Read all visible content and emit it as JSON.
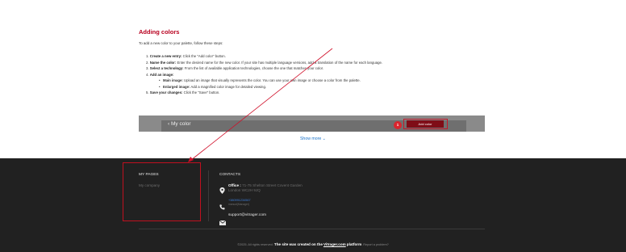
{
  "article": {
    "heading": "Adding colors",
    "intro": "To add a new color to your palette, follow these steps:",
    "steps": [
      {
        "num": "1.",
        "title": "Create a new entry:",
        "text": " Click the \"Add color\" button."
      },
      {
        "num": "2.",
        "title": "Name the color:",
        "text": " Enter the desired name for the new color. If your site has multiple language versions, add a translation of the name for each language."
      },
      {
        "num": "3.",
        "title": "Select a technology:",
        "text": " From the list of available application technologies, choose the one that matches your color."
      },
      {
        "num": "4.",
        "title": "Add an image:",
        "text": ""
      },
      {
        "num": "5.",
        "title": "Save your changes:",
        "text": " Click the \"Save\" button."
      }
    ],
    "substeps": [
      {
        "title": "Main image:",
        "text": " Upload an image that visually represents the color. You can use your own image or choose a color from the palette."
      },
      {
        "title": "Enlarged image:",
        "text": " Add a magnified color image for detailed viewing."
      }
    ]
  },
  "banner": {
    "back_label": "My color",
    "badge": "1",
    "button_label": "Add color"
  },
  "show_more": "Show more",
  "footer": {
    "my_pages": {
      "title": "MY PAGES",
      "link": "My company"
    },
    "contacts": {
      "title": "CONTACTS",
      "office_label": "Office :",
      "office_addr1": "71-75 Shelton Street Covent Garden",
      "office_addr2": "London WC2H 9JQ",
      "phone": "+380991234567",
      "phone_note": "manual(Manager)",
      "email": "support@vitrager.com"
    },
    "copyright": {
      "prefix": "©2025. All rights reserved.",
      "strong_a": "The site was created on the",
      "brand": "Vitrager.com",
      "strong_b": "platform",
      "report": ".Report a problem?"
    }
  },
  "colors": {
    "accent_red": "#b8001f",
    "link_blue": "#1a73c9",
    "footer_bg": "#212121"
  }
}
